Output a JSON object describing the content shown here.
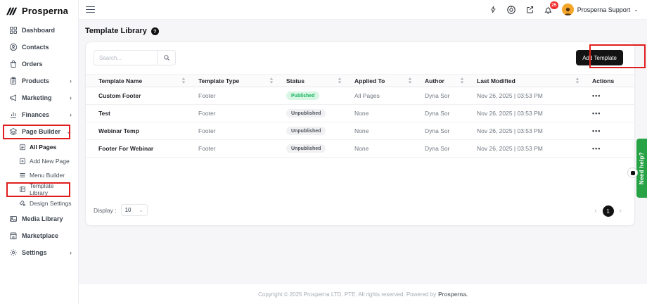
{
  "brand": {
    "name": "Prosperna"
  },
  "header": {
    "user": {
      "name": "Prosperna Support"
    },
    "notifications": {
      "count": "25"
    }
  },
  "sidebar": {
    "items": [
      {
        "label": "Dashboard"
      },
      {
        "label": "Contacts"
      },
      {
        "label": "Orders"
      },
      {
        "label": "Products"
      },
      {
        "label": "Marketing"
      },
      {
        "label": "Finances"
      },
      {
        "label": "Page Builder"
      },
      {
        "label": "All Pages"
      },
      {
        "label": "Add New Page"
      },
      {
        "label": "Menu Builder"
      },
      {
        "label": "Template Library"
      },
      {
        "label": "Design Settings"
      },
      {
        "label": "Media Library"
      },
      {
        "label": "Marketplace"
      },
      {
        "label": "Settings"
      }
    ]
  },
  "page": {
    "title": "Template Library"
  },
  "toolbar": {
    "search_placeholder": "Search...",
    "add_template_label": "Add Template"
  },
  "table": {
    "headers": [
      "Template Name",
      "Template Type",
      "Status",
      "Applied To",
      "Author",
      "Last Modified",
      "Actions"
    ],
    "rows": [
      {
        "name": "Custom Footer",
        "type": "Footer",
        "status": "Published",
        "applied_to": "All Pages",
        "author": "Dyna Sor",
        "last_modified": "Nov 26, 2025 | 03:53 PM"
      },
      {
        "name": "Test",
        "type": "Footer",
        "status": "Unpublished",
        "applied_to": "None",
        "author": "Dyna Sor",
        "last_modified": "Nov 26, 2025 | 03:53 PM"
      },
      {
        "name": "Webinar Temp",
        "type": "Footer",
        "status": "Unpublished",
        "applied_to": "None",
        "author": "Dyna Sor",
        "last_modified": "Nov 26, 2025 | 03:53 PM"
      },
      {
        "name": "Footer For Webinar",
        "type": "Footer",
        "status": "Unpublished",
        "applied_to": "None",
        "author": "Dyna Sor",
        "last_modified": "Nov 26, 2025 | 03:53 PM"
      }
    ]
  },
  "pagination": {
    "display_label": "Display :",
    "page_size": "10",
    "current_page": "1"
  },
  "help_tab": {
    "label": "Need help?"
  },
  "footer": {
    "copyright": "Copyright © 2025 Prosperna LTD. PTE. All rights reserved. Powered by",
    "brand": "Prosperna."
  },
  "icons": {
    "chevron_right": "›",
    "chevron_down": "⌄",
    "ellipsis": "•••",
    "help": "?",
    "prev": "‹",
    "next": "›"
  },
  "colors": {
    "annotation_red": "#e01e1e",
    "published_bg": "#d8f6e4",
    "published_text": "#17b45f",
    "unpublished_bg": "#f1f1f3",
    "unpublished_text": "#4f545c",
    "help_green": "#27a346",
    "button_black": "#131313",
    "avatar_orange": "#f4a62a",
    "badge_red": "#ef2d2d"
  }
}
